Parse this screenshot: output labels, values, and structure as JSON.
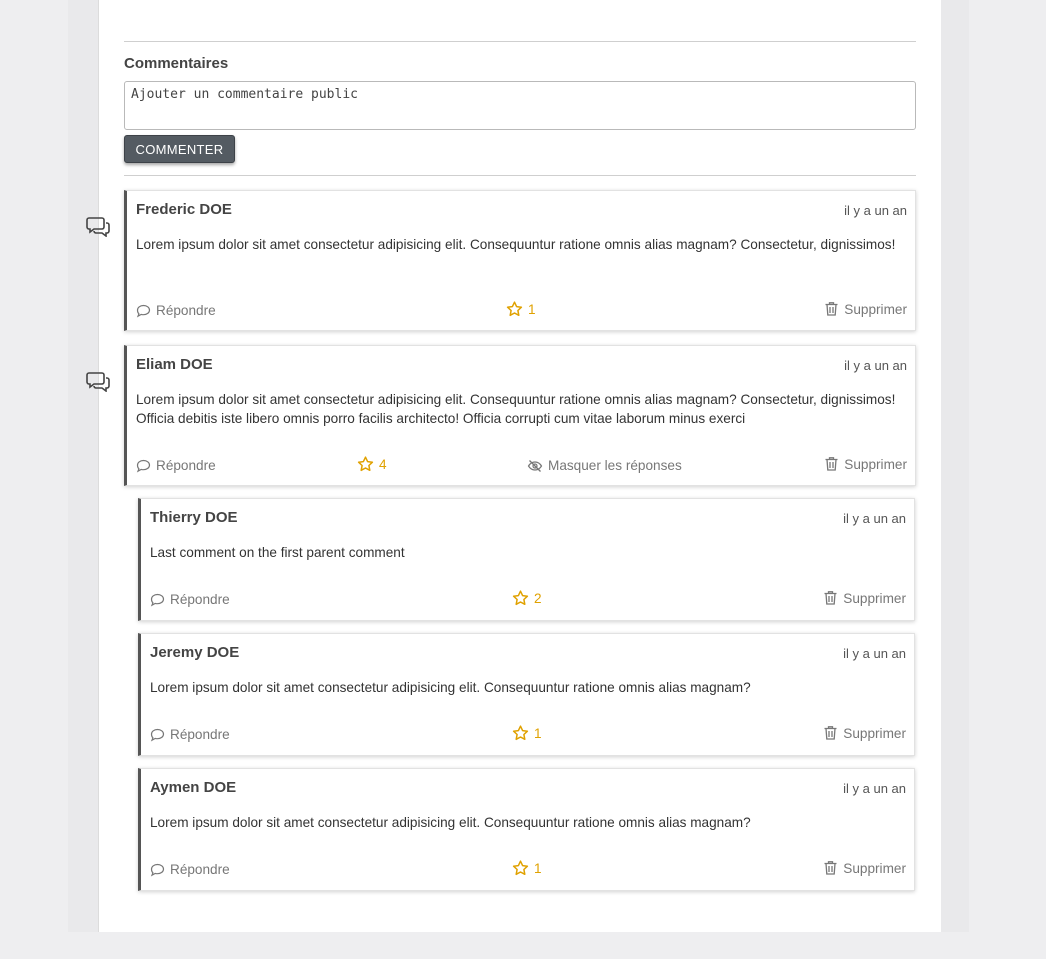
{
  "comments_section": {
    "title": "Commentaires",
    "input_placeholder": "Ajouter un commentaire public",
    "submit_label": "COMMENTER"
  },
  "actions": {
    "reply": "Répondre",
    "delete": "Supprimer",
    "hide_replies": "Masquer les réponses"
  },
  "colors": {
    "star": "#e0a100",
    "button": "#545b62",
    "muted": "#777777"
  },
  "comments": [
    {
      "author": "Frederic DOE",
      "time": "il y a un an",
      "text": "Lorem ipsum dolor sit amet consectetur adipisicing elit. Consequuntur ratione omnis alias magnam? Consectetur, dignissimos!",
      "stars": "1"
    },
    {
      "author": "Eliam DOE",
      "time": "il y a un an",
      "text": "Lorem ipsum dolor sit amet consectetur adipisicing elit. Consequuntur ratione omnis alias magnam? Consectetur, dignissimos! Officia debitis iste libero omnis porro facilis architecto! Officia corrupti cum vitae laborum minus exerci",
      "stars": "4",
      "replies": [
        {
          "author": "Thierry DOE",
          "time": "il y a un an",
          "text": "Last comment on the first parent comment",
          "stars": "2"
        },
        {
          "author": "Jeremy DOE",
          "time": "il y a un an",
          "text": "Lorem ipsum dolor sit amet consectetur adipisicing elit. Consequuntur ratione omnis alias magnam?",
          "stars": "1"
        },
        {
          "author": "Aymen DOE",
          "time": "il y a un an",
          "text": "Lorem ipsum dolor sit amet consectetur adipisicing elit. Consequuntur ratione omnis alias magnam?",
          "stars": "1"
        }
      ]
    }
  ]
}
